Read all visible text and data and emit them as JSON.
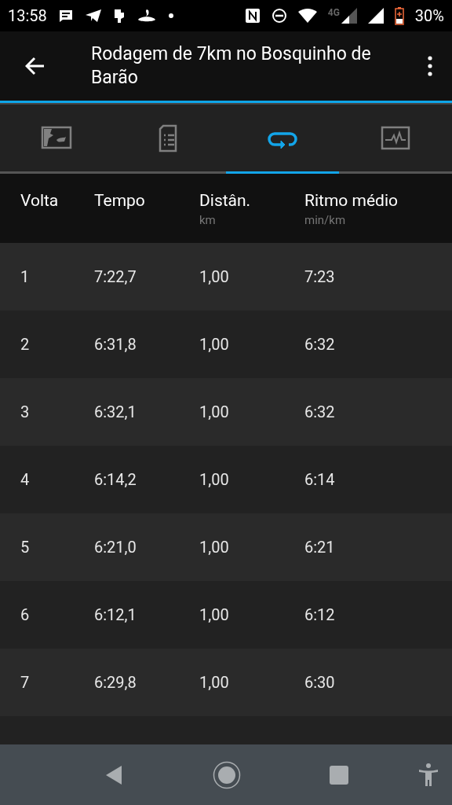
{
  "status_bar": {
    "time": "13:58",
    "network": "4G",
    "battery": "30%"
  },
  "app_bar": {
    "title": "Rodagem de 7km no Bosquinho de Barão"
  },
  "tabs": [
    {
      "kind": "map",
      "selected": false
    },
    {
      "kind": "details",
      "selected": false
    },
    {
      "kind": "laps",
      "selected": true
    },
    {
      "kind": "chart",
      "selected": false
    }
  ],
  "table": {
    "columns": [
      {
        "label": "Volta"
      },
      {
        "label": "Tempo"
      },
      {
        "label": "Distân.",
        "unit": "km"
      },
      {
        "label": "Ritmo médio",
        "unit": "min/km"
      }
    ],
    "rows": [
      [
        "1",
        "7:22,7",
        "1,00",
        "7:23"
      ],
      [
        "2",
        "6:31,8",
        "1,00",
        "6:32"
      ],
      [
        "3",
        "6:32,1",
        "1,00",
        "6:32"
      ],
      [
        "4",
        "6:14,2",
        "1,00",
        "6:14"
      ],
      [
        "5",
        "6:21,0",
        "1,00",
        "6:21"
      ],
      [
        "6",
        "6:12,1",
        "1,00",
        "6:12"
      ],
      [
        "7",
        "6:29,8",
        "1,00",
        "6:30"
      ]
    ]
  }
}
